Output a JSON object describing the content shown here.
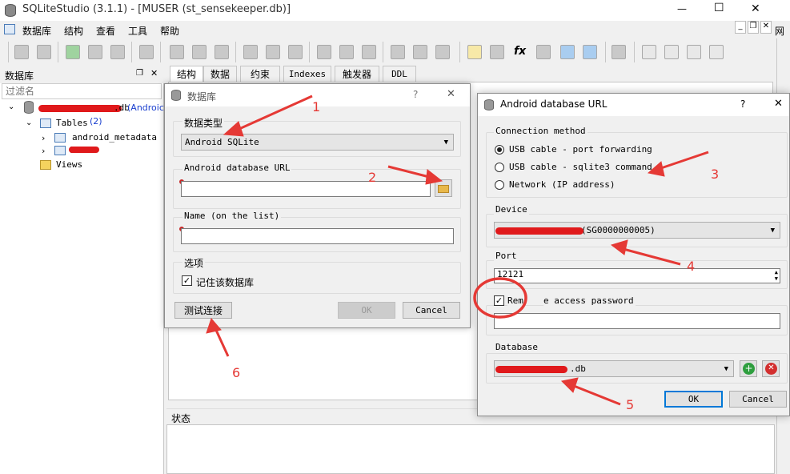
{
  "window": {
    "title": "SQLiteStudio (3.1.1) - [MUSER (st_sensekeeper.db)]",
    "minimize": "—",
    "maximize": "☐",
    "close": "✕"
  },
  "menu": {
    "items": [
      "数据库",
      "结构",
      "查看",
      "工具",
      "帮助"
    ],
    "mdi_min": "_",
    "mdi_restore": "❐",
    "mdi_close": "✕",
    "right_label": "网"
  },
  "left_panel": {
    "title": "数据库",
    "filter_placeholder": "过滤名",
    "db_suffix": ".db",
    "db_type": "(Androic",
    "tables_label": "Tables",
    "tables_count": "(2)",
    "table1": "android_metadata",
    "table2": "M",
    "views_label": "Views"
  },
  "center": {
    "tabs": [
      "结构",
      "数据",
      "约束",
      "Indexes",
      "触发器",
      "DDL"
    ],
    "status_label": "状态"
  },
  "db_dialog": {
    "title": "数据库",
    "help": "?",
    "close": "✕",
    "db_type_label": "数据类型",
    "db_type_value": "Android SQLite",
    "url_label": "Android database URL",
    "url_value": "",
    "name_label": "Name (on the list)",
    "name_value": "",
    "options_label": "选项",
    "remember_label": "记住该数据库",
    "test_button": "测试连接",
    "ok_button": "OK",
    "cancel_button": "Cancel"
  },
  "url_dialog": {
    "title": "Android database URL",
    "help": "?",
    "close": "✕",
    "conn_label": "Connection method",
    "options": [
      "USB cable - port forwarding",
      "USB cable - sqlite3 command",
      "Network (IP address)"
    ],
    "device_label": "Device",
    "device_value": "(SG0000000005)",
    "port_label": "Port",
    "port_value": "12121",
    "remote_pw_prefix": "Rem",
    "remote_pw_suffix": "e access password",
    "password_value": "",
    "database_label": "Database",
    "database_value": ".db",
    "ok_button": "OK",
    "cancel_button": "Cancel"
  },
  "annotations": [
    "1",
    "2",
    "3",
    "4",
    "5",
    "6"
  ],
  "colors": {
    "annotation": "#e53935",
    "link_blue": "#1a3fcf",
    "accent": "#0078d7"
  }
}
